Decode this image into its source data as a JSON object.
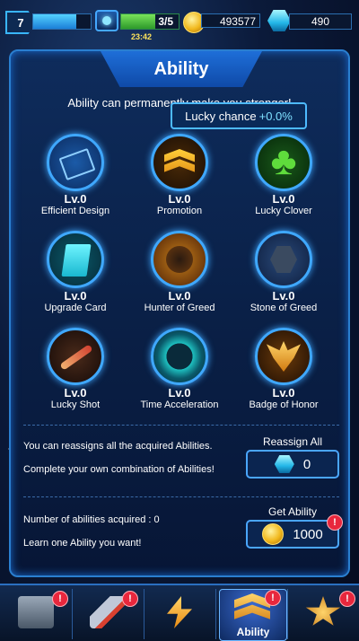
{
  "topbar": {
    "level": "7",
    "xp_progress": 0.75,
    "energy": "3/5",
    "energy_progress": 0.6,
    "timer": "23:42",
    "coins": "493577",
    "gems": "490"
  },
  "panel": {
    "title": "Ability",
    "subtitle": "Ability can permanently make you stronger!",
    "tooltip": {
      "label": "Lucky chance",
      "value": "+0.0%"
    }
  },
  "abilities": [
    {
      "level": "Lv.0",
      "name": "Efficient Design",
      "icon": "circuit-icon"
    },
    {
      "level": "Lv.0",
      "name": "Promotion",
      "icon": "rank-chevron-icon"
    },
    {
      "level": "Lv.0",
      "name": "Lucky Clover",
      "icon": "clover-icon"
    },
    {
      "level": "Lv.0",
      "name": "Upgrade Card",
      "icon": "card-icon"
    },
    {
      "level": "Lv.0",
      "name": "Hunter of Greed",
      "icon": "beast-icon"
    },
    {
      "level": "Lv.0",
      "name": "Stone of Greed",
      "icon": "stone-icon"
    },
    {
      "level": "Lv.0",
      "name": "Lucky Shot",
      "icon": "missile-icon"
    },
    {
      "level": "Lv.0",
      "name": "Time Acceleration",
      "icon": "time-ring-icon"
    },
    {
      "level": "Lv.0",
      "name": "Badge of Honor",
      "icon": "winged-badge-icon"
    }
  ],
  "reassign": {
    "info1": "You can reassigns all the acquired Abilities.",
    "info2": "Complete your own combination of Abilities!",
    "label": "Reassign All",
    "cost": "0"
  },
  "get_ability": {
    "info1": "Number of abilities acquired : 0",
    "info2": "Learn one Ability you want!",
    "label": "Get Ability",
    "cost": "1000",
    "alert": "!"
  },
  "nav": {
    "items": [
      {
        "icon": "chest-icon",
        "label": "",
        "alert": "!"
      },
      {
        "icon": "ship-icon",
        "label": "",
        "alert": "!"
      },
      {
        "icon": "lightning-icon",
        "label": ""
      },
      {
        "icon": "ability-chevron-icon",
        "label": "Ability",
        "alert": "!"
      },
      {
        "icon": "rank-star-icon",
        "label": "",
        "alert": "!"
      }
    ]
  },
  "colors": {
    "accent": "#2a7fd0",
    "highlight": "#7fe0ff",
    "alert": "#e8273d"
  }
}
